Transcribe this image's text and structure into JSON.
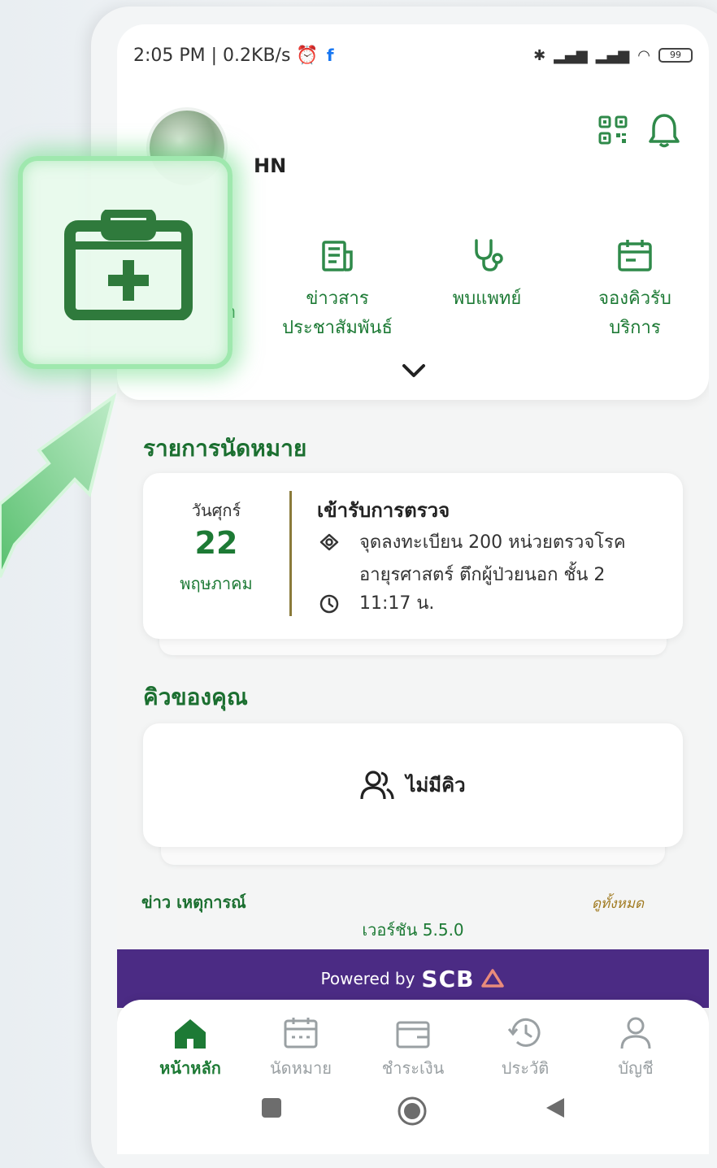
{
  "status_bar": {
    "left_text": "2:05 PM | 0.2KB/s",
    "fb_icon": "f",
    "battery": "99"
  },
  "header": {
    "hn_label": "HN",
    "icons": [
      "qr-code-icon",
      "bell-icon"
    ]
  },
  "menu": {
    "partial_label": "า",
    "items": [
      {
        "icon": "news-icon",
        "line1": "ข่าวสาร",
        "line2": "ประชาสัมพันธ์"
      },
      {
        "icon": "stethoscope-icon",
        "line1": "พบแพทย์",
        "line2": ""
      },
      {
        "icon": "calendar-icon",
        "line1": "จองคิวรับ",
        "line2": "บริการ"
      }
    ]
  },
  "appointments": {
    "title": "รายการนัดหมาย",
    "day": "วันศุกร์",
    "date": "22",
    "month": "พฤษภาคม",
    "visit_title": "เข้ารับการตรวจ",
    "location": "จุดลงทะเบียน 200 หน่วยตรวจโรคอายุรศาสตร์ ตึกผู้ป่วยนอก ชั้น 2",
    "time": "11:17 น."
  },
  "queue": {
    "title": "คิวของคุณ",
    "empty_text": "ไม่มีคิว"
  },
  "footer": {
    "news_left": "ข่าว เหตุการณ์",
    "news_right": "ดูทั้งหมด",
    "version": "เวอร์ชัน 5.5.0",
    "powered_by": "Powered by",
    "scb": "SCB"
  },
  "bottom_nav": [
    {
      "icon": "home-icon",
      "label": "หน้าหลัก",
      "active": true
    },
    {
      "icon": "calendar-icon",
      "label": "นัดหมาย",
      "active": false
    },
    {
      "icon": "wallet-icon",
      "label": "ชำระเงิน",
      "active": false
    },
    {
      "icon": "history-icon",
      "label": "ประวัติ",
      "active": false
    },
    {
      "icon": "user-icon",
      "label": "บัญชี",
      "active": false
    }
  ],
  "colors": {
    "brand_green": "#1d7a35",
    "scb_purple": "#4b2b84",
    "highlight_green": "#9fe8ae"
  }
}
